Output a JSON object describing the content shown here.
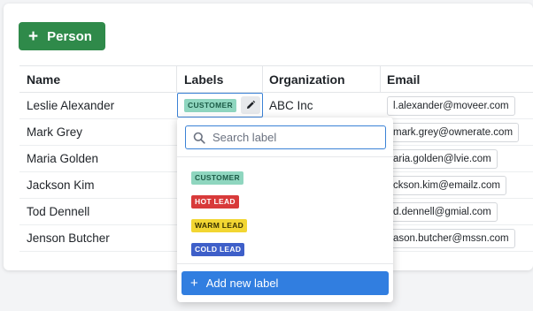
{
  "toolbar": {
    "add_person_label": "Person",
    "plus_glyph": "+"
  },
  "table": {
    "columns": [
      "Name",
      "Labels",
      "Organization",
      "Email"
    ],
    "rows": [
      {
        "name": "Leslie Alexander",
        "label": "CUSTOMER",
        "organization": "ABC Inc",
        "email": "l.alexander@moveer.com"
      },
      {
        "name": "Mark Grey",
        "label": "",
        "organization": "",
        "email": "mark.grey@ownerate.com"
      },
      {
        "name": "Maria Golden",
        "label": "",
        "organization": "",
        "email": "aria.golden@lvie.com"
      },
      {
        "name": "Jackson Kim",
        "label": "",
        "organization": "",
        "email": "ckson.kim@emailz.com"
      },
      {
        "name": "Tod Dennell",
        "label": "",
        "organization": "",
        "email": "d.dennell@gmial.com"
      },
      {
        "name": "Jenson Butcher",
        "label": "",
        "organization": "",
        "email": "ason.butcher@mssn.com"
      }
    ]
  },
  "label_dropdown": {
    "search_placeholder": "Search label",
    "options": [
      {
        "label": "CUSTOMER",
        "color": "#8fd6bf"
      },
      {
        "label": "HOT LEAD",
        "color": "#d83a3a"
      },
      {
        "label": "WARM LEAD",
        "color": "#f2d632"
      },
      {
        "label": "COLD LEAD",
        "color": "#3e5fc9"
      }
    ],
    "add_label": "Add new label",
    "plus_glyph": "+"
  },
  "icons": {
    "search": "search-icon",
    "edit": "pencil-icon",
    "add": "plus-icon"
  },
  "colors": {
    "primary_green": "#2f8a4a",
    "accent_blue": "#317ee0",
    "focus_border": "#3b82d6"
  }
}
